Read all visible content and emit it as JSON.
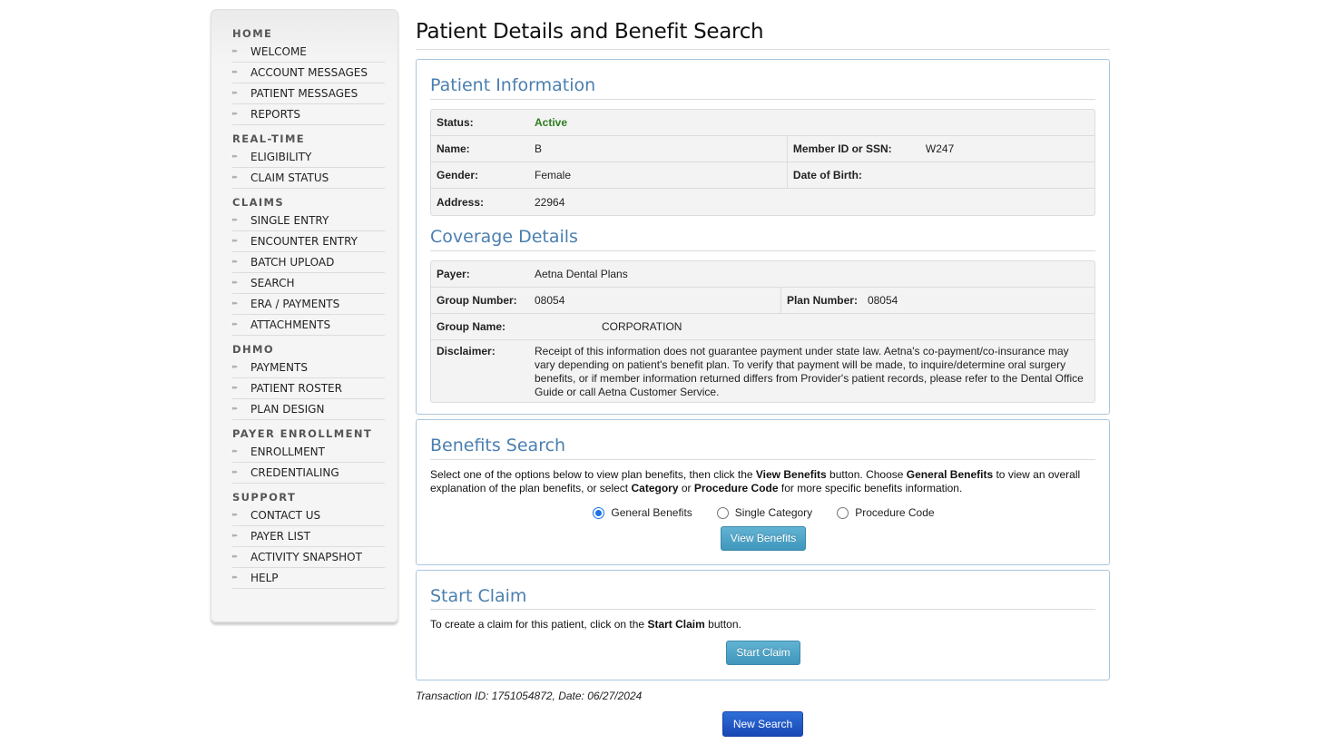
{
  "sidebar": {
    "sections": [
      {
        "heading": "HOME",
        "items": [
          {
            "label": "WELCOME"
          },
          {
            "label": "ACCOUNT MESSAGES"
          },
          {
            "label": "PATIENT MESSAGES"
          },
          {
            "label": "REPORTS"
          }
        ]
      },
      {
        "heading": "REAL-TIME",
        "items": [
          {
            "label": "ELIGIBILITY"
          },
          {
            "label": "CLAIM STATUS"
          }
        ]
      },
      {
        "heading": "CLAIMS",
        "items": [
          {
            "label": "SINGLE ENTRY"
          },
          {
            "label": "ENCOUNTER ENTRY"
          },
          {
            "label": "BATCH UPLOAD"
          },
          {
            "label": "SEARCH"
          },
          {
            "label": "ERA / PAYMENTS"
          },
          {
            "label": "ATTACHMENTS"
          }
        ]
      },
      {
        "heading": "DHMO",
        "items": [
          {
            "label": "PAYMENTS"
          },
          {
            "label": "PATIENT ROSTER"
          },
          {
            "label": "PLAN DESIGN"
          }
        ]
      },
      {
        "heading": "PAYER ENROLLMENT",
        "items": [
          {
            "label": "ENROLLMENT"
          },
          {
            "label": "CREDENTIALING"
          }
        ]
      },
      {
        "heading": "SUPPORT",
        "items": [
          {
            "label": "CONTACT US"
          },
          {
            "label": "PAYER LIST"
          },
          {
            "label": "ACTIVITY SNAPSHOT"
          },
          {
            "label": "HELP"
          }
        ]
      }
    ],
    "bullet_glyph": "▸▸"
  },
  "page": {
    "title": "Patient Details and Benefit Search"
  },
  "patient_info": {
    "title": "Patient Information",
    "status_label": "Status:",
    "status_value": "Active",
    "name_label": "Name:",
    "name_value": "B",
    "member_label": "Member ID or SSN:",
    "member_value": "W247",
    "gender_label": "Gender:",
    "gender_value": "Female",
    "dob_label": "Date of Birth:",
    "dob_value": "",
    "address_label": "Address:",
    "address_value": "22964"
  },
  "coverage": {
    "title": "Coverage Details",
    "payer_label": "Payer:",
    "payer_value": "Aetna Dental Plans",
    "group_number_label": "Group Number:",
    "group_number_value": "08054",
    "plan_number_label": "Plan Number:",
    "plan_number_value": "08054",
    "group_name_label": "Group Name:",
    "group_name_value": "CORPORATION",
    "disclaimer_label": "Disclaimer:",
    "disclaimer_value": "Receipt of this information does not guarantee payment under state law. Aetna's co-payment/co-insurance may vary depending on patient's benefit plan. To verify that payment will be made, to inquire/determine oral surgery benefits, or if member information returned differs from Provider's patient records, please refer to the Dental Office Guide or call Aetna Customer Service."
  },
  "benefits": {
    "title": "Benefits Search",
    "desc_1": "Select one of the options below to view plan benefits, then click the ",
    "desc_b1": "View Benefits",
    "desc_2": " button. Choose ",
    "desc_b2": "General Benefits",
    "desc_3": " to view an overall explanation of the plan benefits, or select ",
    "desc_b3": "Category",
    "desc_4": " or ",
    "desc_b4": "Procedure Code",
    "desc_5": " for more specific benefits information.",
    "options": [
      {
        "label": "General Benefits",
        "selected": true
      },
      {
        "label": "Single Category",
        "selected": false
      },
      {
        "label": "Procedure Code",
        "selected": false
      }
    ],
    "button_label": "View Benefits"
  },
  "start_claim": {
    "title": "Start Claim",
    "desc_1": "To create a claim for this patient, click on the ",
    "desc_b": "Start Claim",
    "desc_2": " button.",
    "button_label": "Start Claim"
  },
  "footer": {
    "transaction": "Transaction ID: 1751054872, Date: 06/27/2024",
    "new_search_label": "New Search"
  },
  "colors": {
    "accent_blue": "#4a7fb0",
    "status_active": "#2e7d1f",
    "button_teal": "#4aa3c7",
    "button_blue": "#1f57c3"
  }
}
